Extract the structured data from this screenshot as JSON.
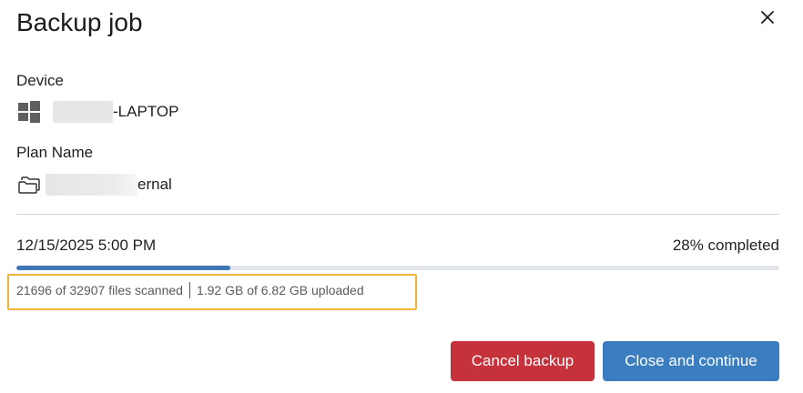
{
  "dialog": {
    "title": "Backup job"
  },
  "device": {
    "label": "Device",
    "icon": "windows-icon",
    "name_suffix": "-LAPTOP"
  },
  "plan": {
    "label": "Plan Name",
    "icon": "folder-icon",
    "name_suffix": "ernal"
  },
  "job": {
    "datetime": "12/15/2025 5:00 PM",
    "completed_text": "28% completed",
    "progress": 0.28,
    "files_scanned": "21696 of 32907 files scanned",
    "uploaded": "1.92 GB of 6.82 GB uploaded"
  },
  "buttons": {
    "cancel": "Cancel backup",
    "close_continue": "Close and continue"
  },
  "colors": {
    "cancel_button": "#c6323c",
    "primary_button": "#3a7ec0",
    "progress_fill": "#3f77b6",
    "highlight_box": "#f0b53a"
  }
}
